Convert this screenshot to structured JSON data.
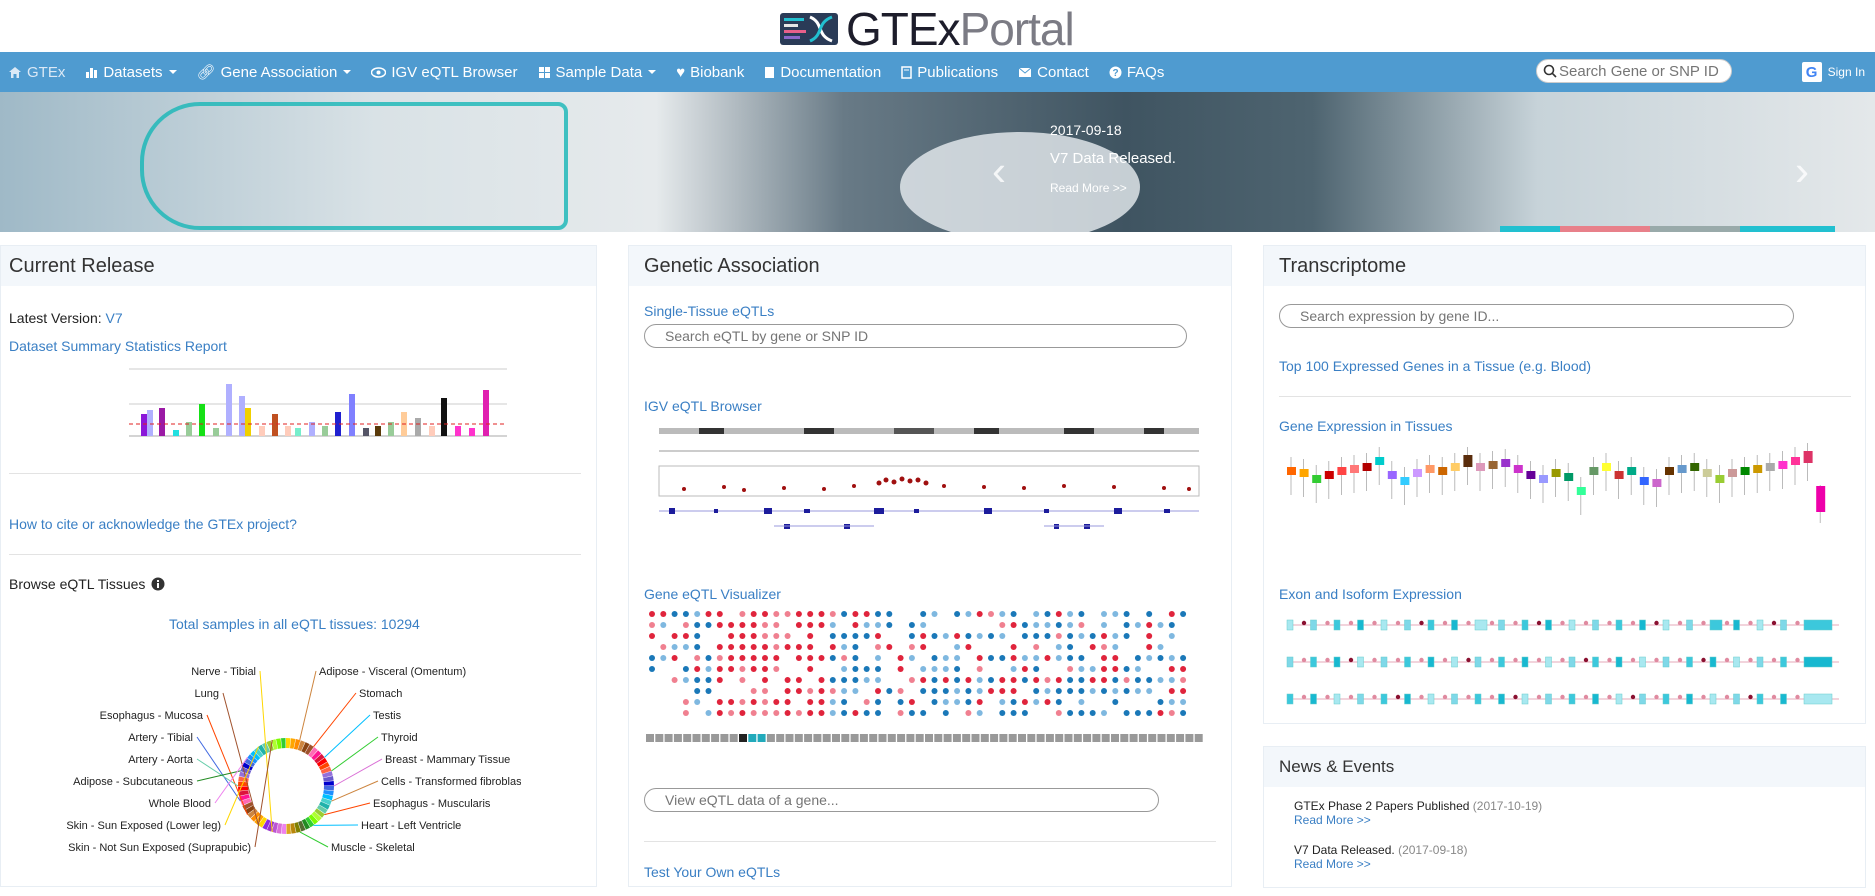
{
  "header": {
    "logo_bold": "GTEx",
    "logo_light": "Portal"
  },
  "nav": {
    "items": [
      {
        "label": "GTEx",
        "icon": "home-icon"
      },
      {
        "label": "Datasets",
        "icon": "bar-chart-icon",
        "dropdown": true
      },
      {
        "label": "Gene Association",
        "icon": "link-icon",
        "dropdown": true
      },
      {
        "label": "IGV eQTL Browser",
        "icon": "eye-icon"
      },
      {
        "label": "Sample Data",
        "icon": "grid-icon",
        "dropdown": true
      },
      {
        "label": "Biobank",
        "icon": "heart-icon"
      },
      {
        "label": "Documentation",
        "icon": "document-icon"
      },
      {
        "label": "Publications",
        "icon": "book-icon"
      },
      {
        "label": "Contact",
        "icon": "envelope-icon"
      },
      {
        "label": "FAQs",
        "icon": "question-icon"
      }
    ],
    "search_placeholder": "Search Gene or SNP ID...",
    "signin_label": "Sign In",
    "google_letter": "G"
  },
  "banner": {
    "date": "2017-09-18",
    "title": "V7 Data Released.",
    "more": "Read More >>"
  },
  "current_release": {
    "title": "Current Release",
    "version_label": "Latest Version:",
    "version": "V7",
    "summary_link": "Dataset Summary Statistics Report",
    "cite_link": "How to cite or acknowledge the GTEx project?",
    "browse_title": "Browse eQTL Tissues",
    "total_samples": "Total samples in all eQTL tissues: 10294",
    "tissue_labels_left": [
      "Nerve - Tibial",
      "Lung",
      "Esophagus - Mucosa",
      "Artery - Tibial",
      "Artery - Aorta",
      "Adipose - Subcutaneous",
      "Whole Blood",
      "Skin - Sun Exposed (Lower leg)",
      "Skin - Not Sun Exposed (Suprapubic)"
    ],
    "tissue_labels_right": [
      "Adipose - Visceral (Omentum)",
      "Stomach",
      "Testis",
      "Thyroid",
      "Breast - Mammary Tissue",
      "Cells - Transformed fibroblasts",
      "Esophagus - Muscularis",
      "Heart - Left Ventricle",
      "Muscle - Skeletal"
    ]
  },
  "genetic_association": {
    "title": "Genetic Association",
    "single_tissue": "Single-Tissue eQTLs",
    "single_tissue_placeholder": "Search eQTL by gene or SNP ID",
    "igv_link": "IGV eQTL Browser",
    "visualizer_link": "Gene eQTL Visualizer",
    "visualizer_placeholder": "View eQTL data of a gene...",
    "test_link": "Test Your Own eQTLs"
  },
  "transcriptome": {
    "title": "Transcriptome",
    "search_placeholder": "Search expression by gene ID...",
    "top100_link": "Top 100 Expressed Genes in a Tissue (e.g. Blood)",
    "expression_link": "Gene Expression in Tissues",
    "exon_link": "Exon and Isoform Expression"
  },
  "news": {
    "title": "News & Events",
    "items": [
      {
        "title": "GTEx Phase 2 Papers Published",
        "date": "(2017-10-19)",
        "more": "Read More >>"
      },
      {
        "title": "V7 Data Released.",
        "date": "(2017-09-18)",
        "more": "Read More >>"
      }
    ]
  },
  "colors": {
    "nav": "#4f9bd0",
    "link": "#3a7fc4",
    "panel_head": "#f3f7fb"
  }
}
